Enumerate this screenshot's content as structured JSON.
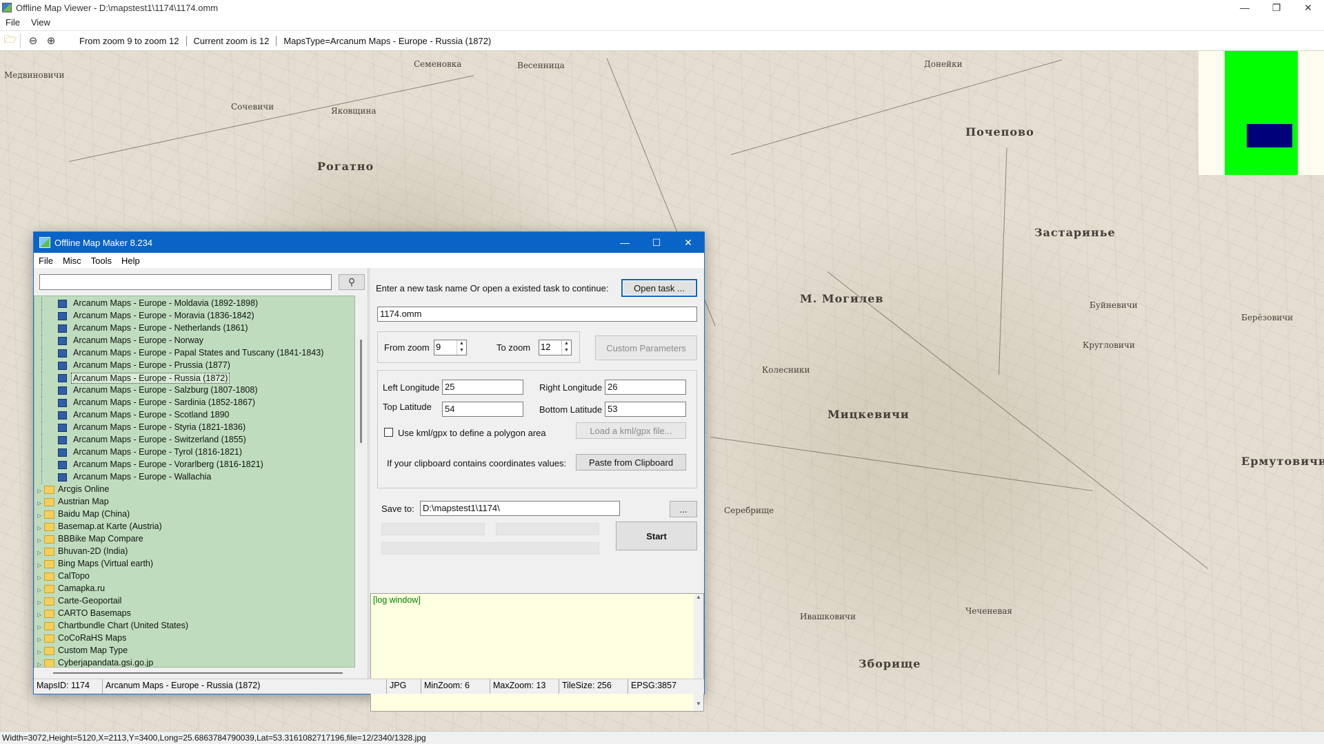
{
  "app": {
    "title": "Offline Map Viewer - D:\\mapstest1\\1174\\1174.omm",
    "window_controls": [
      "—",
      "❐",
      "✕"
    ],
    "menu": [
      "File",
      "View"
    ]
  },
  "toolbar": {
    "zoom_range": "From zoom 9 to zoom 12",
    "current_zoom": "Current zoom is 12",
    "maps_type": "MapsType=Arcanum Maps - Europe - Russia (1872)"
  },
  "map_labels": [
    "Медвиновичи",
    "Семеновка",
    "Весенница",
    "Донейки",
    "Яковщина",
    "Рогатно",
    "Почепово",
    "Застаринье",
    "Ермутовичи",
    "М. Могилев",
    "Колесники",
    "Мицкевичи",
    "Серебрище",
    "Чеченевая",
    "Ивашковичи",
    "Зборище",
    "Буйневичи",
    "Кругловичи",
    "Берёзовичи",
    "Сочевичи"
  ],
  "status_bar": "Width=3072,Height=5120,X=2113,Y=3400,Long=25.6863784790039,Lat=53.3161082717196,file=12/2340/1328.jpg",
  "dialog": {
    "title": "Offline Map Maker 8.234",
    "menu": [
      "File",
      "Misc",
      "Tools",
      "Help"
    ],
    "search": {
      "value": "",
      "placeholder": ""
    },
    "tree_leaves": [
      "Arcanum Maps - Europe - Moldavia (1892-1898)",
      "Arcanum Maps - Europe - Moravia (1836-1842)",
      "Arcanum Maps - Europe - Netherlands (1861)",
      "Arcanum Maps - Europe - Norway",
      "Arcanum Maps - Europe - Papal States and Tuscany (1841-1843)",
      "Arcanum Maps - Europe - Prussia (1877)",
      "Arcanum Maps - Europe - Russia (1872)",
      "Arcanum Maps - Europe - Salzburg (1807-1808)",
      "Arcanum Maps - Europe - Sardinia (1852-1867)",
      "Arcanum Maps - Europe - Scotland 1890",
      "Arcanum Maps - Europe - Styria (1821-1836)",
      "Arcanum Maps - Europe - Switzerland (1855)",
      "Arcanum Maps - Europe - Tyrol (1816-1821)",
      "Arcanum Maps - Europe - Vorarlberg (1816-1821)",
      "Arcanum Maps - Europe - Wallachia"
    ],
    "selected_leaf": "Arcanum Maps - Europe - Russia (1872)",
    "tree_folders": [
      "Arcgis Online",
      "Austrian Map",
      "Baidu Map (China)",
      "Basemap.at Karte (Austria)",
      "BBBike Map Compare",
      "Bhuvan-2D (India)",
      "Bing Maps (Virtual earth)",
      "CalTopo",
      "Camapka.ru",
      "Carte-Geoportail",
      "CARTO Basemaps",
      "Chartbundle Chart (United States)",
      "CoCoRaHS Maps",
      "Custom Map Type",
      "Cyberjapandata.gsi.go.jp"
    ],
    "task_prompt": "Enter a new task name Or open a existed task to continue:",
    "open_task_label": "Open task ...",
    "task_name": "1174.omm",
    "from_zoom_label": "From zoom",
    "from_zoom_value": "9",
    "to_zoom_label": "To zoom",
    "to_zoom_value": "12",
    "custom_params_label": "Custom Parameters",
    "left_long_label": "Left Longitude",
    "left_long_value": "25",
    "right_long_label": "Right Longitude",
    "right_long_value": "26",
    "top_lat_label": "Top Latitude",
    "top_lat_value": "54",
    "bottom_lat_label": "Bottom Latitude",
    "bottom_lat_value": "53",
    "kml_checkbox_label": "Use kml/gpx to define a polygon area",
    "kml_checked": false,
    "load_kml_label": "Load a kml/gpx file...",
    "clipboard_prompt": "If your clipboard contains coordinates values:",
    "paste_label": "Paste from Clipboard",
    "save_to_label": "Save to:",
    "save_to_value": "D:\\mapstest1\\1174\\",
    "browse_label": "...",
    "start_label": "Start",
    "log_text": "[log window]",
    "status": {
      "maps_id": "MapsID: 1174",
      "map_name": "Arcanum Maps - Europe - Russia (1872)",
      "format": "JPG",
      "min_zoom": "MinZoom: 6",
      "max_zoom": "MaxZoom: 13",
      "tile_size": "TileSize: 256",
      "epsg": "EPSG:3857"
    }
  },
  "colors": {
    "dialog_title_bg": "#0a64c8",
    "tree_bg": "#bfddbe",
    "log_bg": "#ffffe1",
    "log_text": "#008000",
    "overview_area": "#00ff00",
    "overview_view": "#00007a"
  }
}
